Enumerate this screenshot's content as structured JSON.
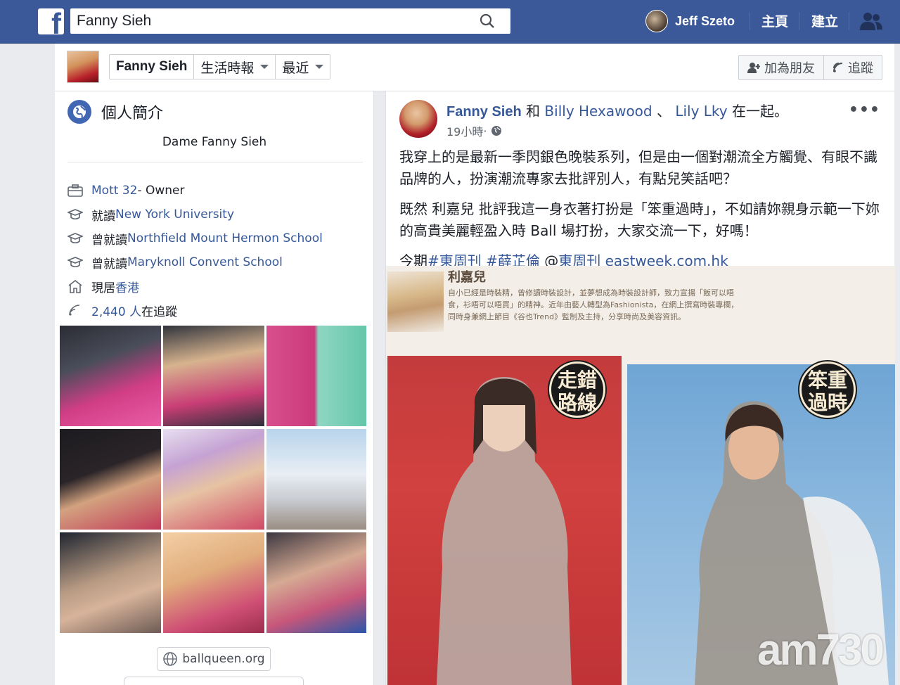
{
  "topbar": {
    "search_value": "Fanny Sieh",
    "user_name": "Jeff Szeto",
    "home_label": "主頁",
    "create_label": "建立"
  },
  "subheader": {
    "profile_name": "Fanny Sieh",
    "timeline_label": "生活時報",
    "recent_label": "最近",
    "add_friend_label": "加為朋友",
    "follow_label": "追蹤"
  },
  "intro": {
    "title": "個人簡介",
    "bio": "Dame Fanny Sieh",
    "work_org": "Mott 32",
    "work_role": " - Owner",
    "edu1_prefix": "就讀 ",
    "edu1_school": "New York University",
    "edu2_prefix": "曾就讀 ",
    "edu2_school": "Northfield Mount Hermon School",
    "edu3_prefix": "曾就讀 ",
    "edu3_school": "Maryknoll Convent School",
    "lives_prefix": "現居",
    "lives_place": "香港",
    "followers_count": "2,440 人",
    "followers_suffix": "在追蹤",
    "website": "ballqueen.org"
  },
  "post": {
    "author": "Fanny Sieh",
    "with_word": " 和 ",
    "tagged1": "Billy Hexawood",
    "separator": " 、 ",
    "tagged2": "Lily Lky",
    "with_suffix": " 在一起。",
    "time": "19小時",
    "paragraph1": "我穿上的是最新一季閃銀色晚裝系列，但是由一個對潮流全方觸覺、有眼不識品牌的人，扮演潮流專家去批評別人，有點兒笑話吧？",
    "paragraph2": "既然 利嘉兒 批評我這一身衣著打扮是「笨重過時」，不如請妳親身示範一下妳的高貴美麗輕盈入時 Ball 場打扮，大家交流一下，好嗎！",
    "p3_prefix": "今期",
    "p3_tag1": "#東周刊",
    "p3_tag2": "#薛芷倫",
    "p3_at": "@",
    "p3_mention": "東周刊",
    "p3_link": "eastweek.com.hk",
    "more_label": "•••"
  },
  "magazine": {
    "name": "利嘉兒",
    "text": "自小已經是時裝精，曾修讀時裝設計，並夢想成為時裝設計師，致力宣揚「飯可以唔食，衫唔可以唔買」的精神。近年由藝人轉型為Fashionista，在網上撰寫時裝專欄，同時身兼網上節目《谷也Trend》監制及主持，分享時尚及美容資訊。",
    "seal1": "走錯路線",
    "seal2": "笨重過時",
    "watermark": "am730"
  }
}
